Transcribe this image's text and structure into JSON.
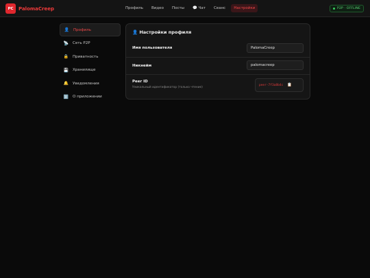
{
  "brand": {
    "logo": "PC",
    "name": "PalomaCreep"
  },
  "nav": {
    "items": [
      {
        "label": "Профиль"
      },
      {
        "label": "Видео"
      },
      {
        "label": "Посты"
      },
      {
        "label": "💬 Чат"
      },
      {
        "label": "Сеанс"
      },
      {
        "label": "Настройки"
      }
    ]
  },
  "status": {
    "text": "P2P · OFFLINE",
    "color": "#38d15d"
  },
  "sidebar": {
    "items": [
      {
        "icon": "👤",
        "icon_name": "user-icon",
        "label": "Профиль"
      },
      {
        "icon": "📡",
        "icon_name": "antenna-icon",
        "label": "Сеть P2P"
      },
      {
        "icon": "🔒",
        "icon_name": "lock-icon",
        "label": "Приватность"
      },
      {
        "icon": "💾",
        "icon_name": "disk-icon",
        "label": "Хранилище"
      },
      {
        "icon": "🔔",
        "icon_name": "bell-icon",
        "label": "Уведомления"
      },
      {
        "icon": "ℹ️",
        "icon_name": "info-icon",
        "label": "О приложении"
      }
    ]
  },
  "panel": {
    "title": "👤 Настройки профиля",
    "username": {
      "label": "Имя пользователя",
      "value": "PalomaCreep"
    },
    "nickname": {
      "label": "Никнейм",
      "value": "palomacreep"
    },
    "peer": {
      "label": "Peer ID",
      "sub": "Уникальный идентификатор (только чтение)",
      "value": "peer-7f3a8b4c"
    }
  },
  "colors": {
    "accent": "#e0272e",
    "background": "#0a0a0a",
    "panel": "#151515"
  }
}
